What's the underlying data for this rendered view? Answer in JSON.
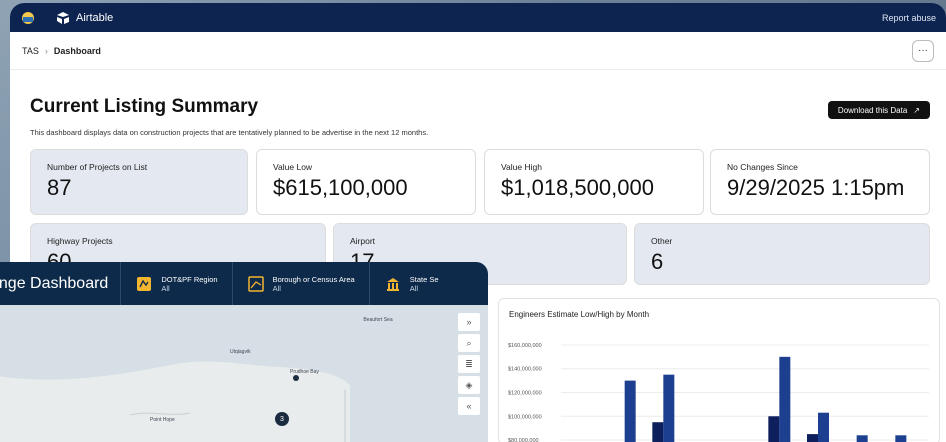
{
  "topbar": {
    "app_name": "Airtable",
    "report_label": "Report abuse"
  },
  "breadcrumb": {
    "root": "TAS",
    "separator": "›",
    "current": "Dashboard",
    "more": "···"
  },
  "page": {
    "title": "Current Listing Summary",
    "description": "This dashboard displays data on construction projects that are tentatively planned to be advertise in the next 12 months.",
    "download_label": "Download this Data",
    "download_icon": "↗"
  },
  "stats": {
    "projects": {
      "label": "Number of Projects on List",
      "value": "87"
    },
    "value_low": {
      "label": "Value Low",
      "value": "$615,100,000"
    },
    "value_high": {
      "label": "Value High",
      "value": "$1,018,500,000"
    },
    "no_changes": {
      "label": "No Changes Since",
      "value": "9/29/2025 1:15pm"
    },
    "highway": {
      "label": "Highway Projects",
      "value": "60"
    },
    "airport": {
      "label": "Airport",
      "value": "17"
    },
    "other": {
      "label": "Other",
      "value": "6"
    }
  },
  "map": {
    "title": "ange Dashboard",
    "filters": [
      {
        "name": "DOT&PF Region",
        "value": "All"
      },
      {
        "name": "Borough or Census Area",
        "value": "All"
      },
      {
        "name": "State Se",
        "value": "All"
      }
    ],
    "places": {
      "beaufort": "Beaufort Sea",
      "utqiagvik": "Utqiagvik",
      "prudhoe": "Prudhoe Bay",
      "point_hope": "Point Hope"
    },
    "cluster_count": "3",
    "tools": [
      "»",
      "⌕",
      "≣",
      "◈",
      "«"
    ]
  },
  "chart_data": {
    "type": "bar",
    "title": "Engineers Estimate Low/High by Month",
    "yticks": [
      "$160,000,000",
      "$140,000,000",
      "$120,000,000",
      "$100,000,000",
      "$80,000,000"
    ],
    "ylim": [
      75000000,
      165000000
    ],
    "series": [
      {
        "color": "#0d1f5c",
        "values": [
          null,
          null,
          95000000,
          null,
          null,
          100000000,
          85000000,
          null,
          null
        ]
      },
      {
        "color": "#1c3f8f",
        "values": [
          null,
          130000000,
          135000000,
          78000000,
          null,
          150000000,
          103000000,
          84000000,
          84000000
        ]
      }
    ],
    "series_color_extra": "#1c3f8f",
    "extra_bars": [
      {
        "group": 0,
        "value": 78000000
      }
    ]
  }
}
